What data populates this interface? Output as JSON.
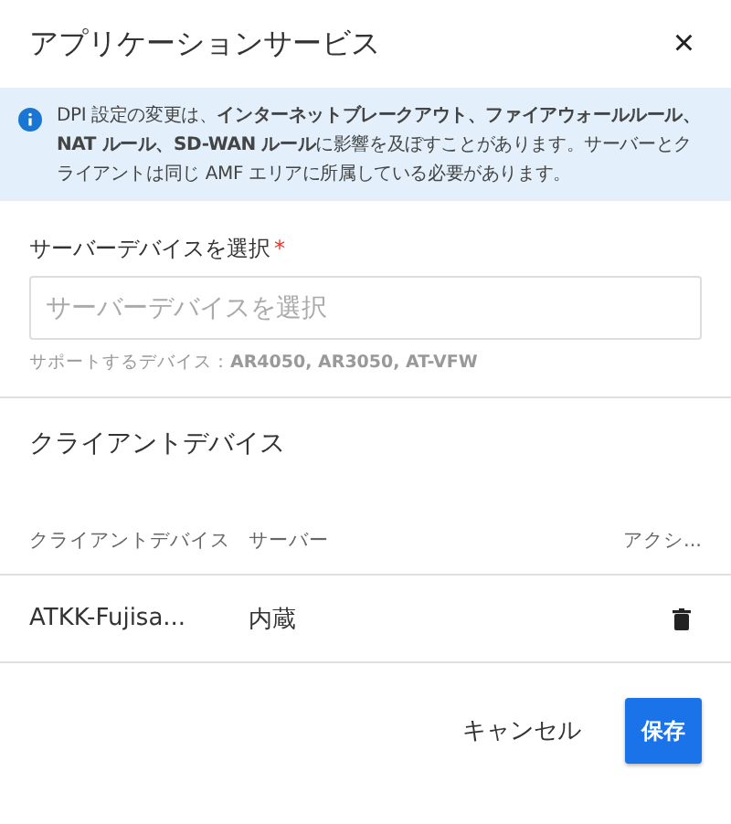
{
  "dialog": {
    "title": "アプリケーションサービス",
    "close": "×"
  },
  "notice": {
    "text": "DPI 設定の変更は、**インターネットブレークアウト、ファイアウォールルール、NAT ルール、SD-WAN ルール**に影響を及ぼすことがあります。サーバーとクライアントは同じ AMF エリアに所属している必要があります。"
  },
  "server_field": {
    "label": "サーバーデバイスを選択",
    "required_mark": "*",
    "placeholder": "サーバーデバイスを選択",
    "hint": "サポートするデバイス：**AR4050, AR3050, AT-VFW**"
  },
  "client_section": {
    "title": "クライアントデバイス",
    "columns": [
      "クライアントデバイス",
      "サーバー",
      "アクシ..."
    ],
    "rows": [
      {
        "cells": [
          "ATKK-Fujisa...",
          "内蔵"
        ]
      }
    ]
  },
  "buttons": {
    "cancel": "キャンセル",
    "save": "保存"
  }
}
